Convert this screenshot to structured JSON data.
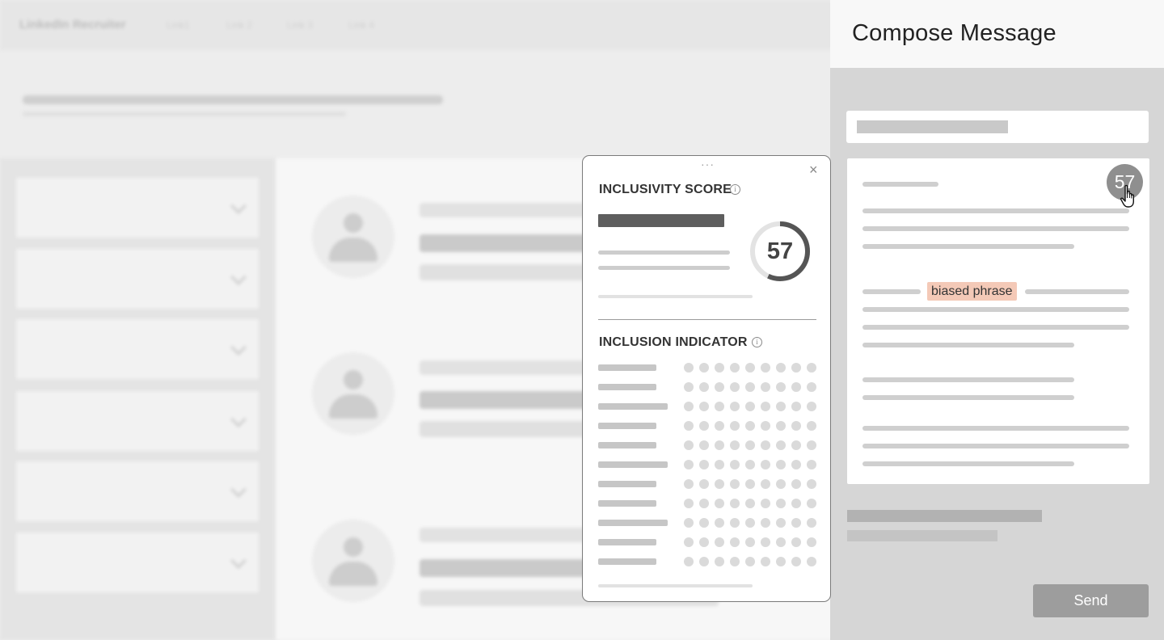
{
  "background_app": {
    "brand": "LinkedIn Recruiter",
    "nav_links": [
      "Link1",
      "Link 2",
      "Link 3",
      "Link 4"
    ]
  },
  "compose": {
    "title": "Compose Message",
    "highlighted_text": "biased phrase",
    "score_badge": "57",
    "send_label": "Send",
    "highlight_color": "#f4c9b7"
  },
  "popup": {
    "drag_handle": "···",
    "close_glyph": "×",
    "info_glyph": "i",
    "score_title": "INCLUSIVITY SCORE",
    "score_value": "57",
    "score_fraction": 0.57,
    "indicator_title": "INCLUSION INDICATOR",
    "indicator_rows": 11,
    "dots_per_row": 9
  },
  "icons": {
    "cursor": "hand-pointer-icon",
    "avatar": "person-placeholder-icon",
    "info": "info-icon",
    "close": "close-icon",
    "expand": "chevron-down-icon"
  }
}
